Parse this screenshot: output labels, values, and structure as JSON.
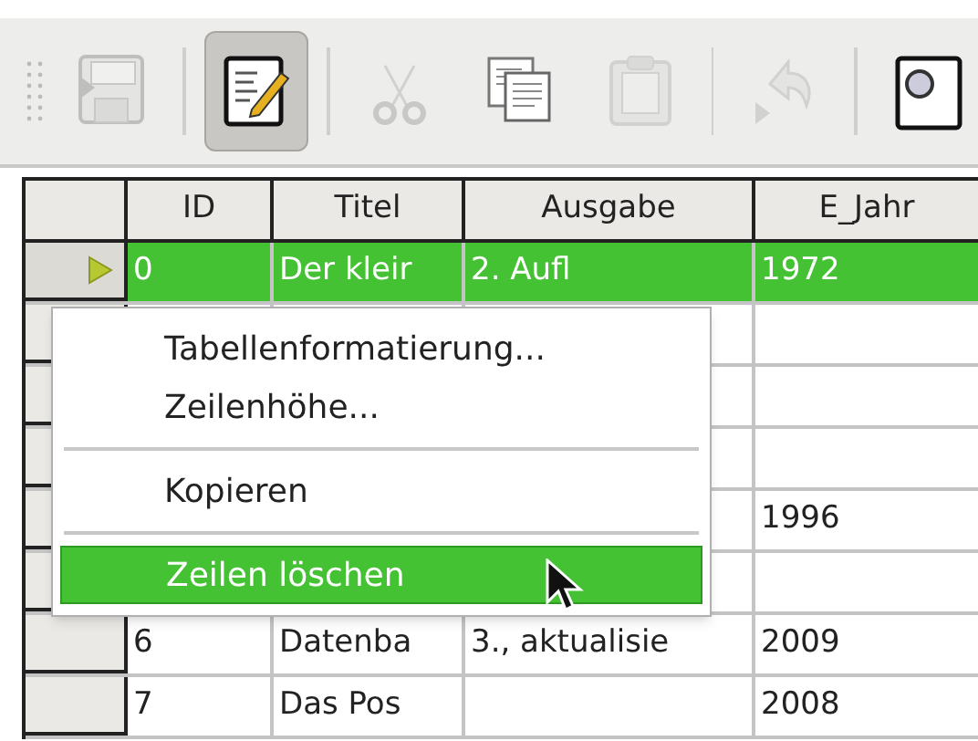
{
  "toolbar": {
    "tools": [
      {
        "kind": "grip"
      },
      {
        "kind": "save",
        "disabled": true,
        "pressed": false
      },
      {
        "kind": "separator"
      },
      {
        "kind": "edit",
        "disabled": false,
        "pressed": true
      },
      {
        "kind": "separator"
      },
      {
        "kind": "cut",
        "disabled": true,
        "pressed": false
      },
      {
        "kind": "copy",
        "disabled": false,
        "pressed": false
      },
      {
        "kind": "paste",
        "disabled": true,
        "pressed": false
      },
      {
        "kind": "separator"
      },
      {
        "kind": "undo",
        "disabled": true,
        "pressed": false
      },
      {
        "kind": "separator"
      },
      {
        "kind": "find",
        "disabled": false,
        "pressed": false
      }
    ]
  },
  "table": {
    "columns": [
      "ID",
      "Titel",
      "Ausgabe",
      "E_Jahr"
    ],
    "rows": [
      {
        "cells": [
          "0",
          "Der kleir",
          "2. Aufl",
          "1972"
        ],
        "selected": true
      },
      {
        "cells": [
          "",
          "",
          "",
          ""
        ],
        "selected": false
      },
      {
        "cells": [
          "",
          "",
          "",
          ""
        ],
        "selected": false
      },
      {
        "cells": [
          "",
          "",
          "",
          ""
        ],
        "selected": false
      },
      {
        "cells": [
          "",
          "",
          "",
          "1996"
        ],
        "selected": false
      },
      {
        "cells": [
          "",
          "",
          "",
          ""
        ],
        "selected": false
      },
      {
        "cells": [
          "6",
          "Datenba",
          "3., aktualisie",
          "2009"
        ],
        "selected": false
      },
      {
        "cells": [
          "7",
          "Das Pos",
          "",
          "2008"
        ],
        "selected": false
      }
    ]
  },
  "context_menu": {
    "items": [
      {
        "kind": "item",
        "label": "Tabellenformatierung...",
        "selected": false
      },
      {
        "kind": "item",
        "label": "Zeilenhöhe...",
        "selected": false
      },
      {
        "kind": "separator"
      },
      {
        "kind": "item",
        "label": "Kopieren",
        "selected": false
      },
      {
        "kind": "separator"
      },
      {
        "kind": "item",
        "label": "Zeilen löschen",
        "selected": true
      }
    ]
  }
}
